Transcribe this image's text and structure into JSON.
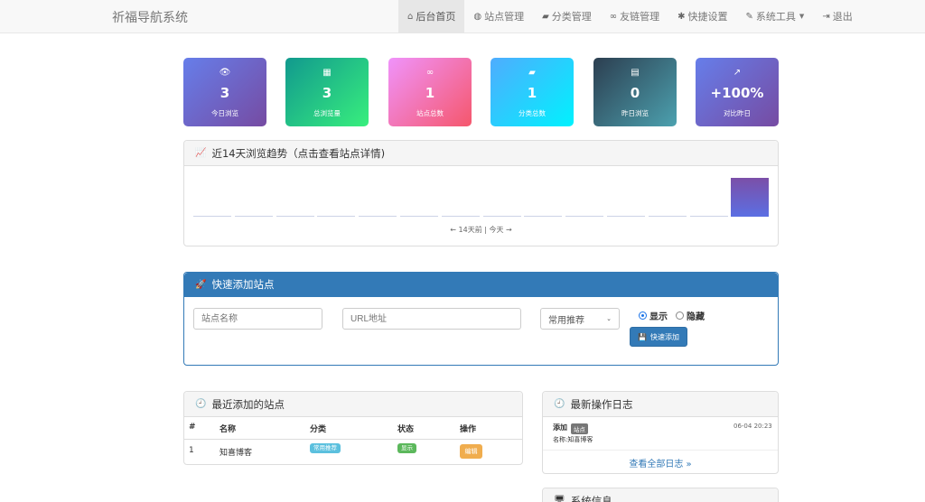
{
  "brand": "祈福导航系统",
  "nav": {
    "items": [
      {
        "label": "后台首页",
        "icon": "home-icon",
        "glyph": "⌂"
      },
      {
        "label": "站点管理",
        "icon": "globe-icon",
        "glyph": "◍"
      },
      {
        "label": "分类管理",
        "icon": "folder-open-icon",
        "glyph": "▰"
      },
      {
        "label": "友链管理",
        "icon": "link-icon",
        "glyph": "∞"
      },
      {
        "label": "快捷设置",
        "icon": "gear-icon",
        "glyph": "✱"
      },
      {
        "label": "系统工具",
        "icon": "wrench-icon",
        "glyph": "✎"
      },
      {
        "label": "退出",
        "icon": "logout-icon",
        "glyph": "⇥"
      }
    ]
  },
  "stats": [
    {
      "value": "3",
      "label": "今日浏览",
      "icon": "eye-icon",
      "glyph": "👁",
      "colors": [
        "#667eea",
        "#764ba2"
      ]
    },
    {
      "value": "3",
      "label": "总浏览量",
      "icon": "bar-chart-icon",
      "glyph": "▦",
      "colors": [
        "#11998e",
        "#38ef7d"
      ]
    },
    {
      "value": "1",
      "label": "站点总数",
      "icon": "link-icon",
      "glyph": "∞",
      "colors": [
        "#f093fb",
        "#f5576c"
      ]
    },
    {
      "value": "1",
      "label": "分类总数",
      "icon": "folder-icon",
      "glyph": "▰",
      "colors": [
        "#4facfe",
        "#00f2fe"
      ]
    },
    {
      "value": "0",
      "label": "昨日浏览",
      "icon": "calendar-icon",
      "glyph": "▤",
      "colors": [
        "#2c3e50",
        "#4ca1af"
      ]
    },
    {
      "value": "+100%",
      "label": "对比昨日",
      "icon": "trend-icon",
      "glyph": "↗",
      "colors": [
        "#667eea",
        "#764ba2"
      ]
    }
  ],
  "trend": {
    "title": "近14天浏览趋势（点击查看站点详情)",
    "icon": "trend-chart-icon",
    "footer": "← 14天前 | 今天 →"
  },
  "chart_data": {
    "type": "bar",
    "title": "近14天浏览趋势（点击查看站点详情)",
    "values": [
      0,
      0,
      0,
      0,
      0,
      0,
      0,
      0,
      0,
      0,
      0,
      0,
      0,
      3
    ],
    "xlabel": "← 14天前 | 今天 →",
    "ylabel": "",
    "grid": false
  },
  "quick_add": {
    "title": "快速添加站点",
    "name_placeholder": "站点名称",
    "url_placeholder": "URL地址",
    "category_selected": "常用推荐",
    "show_label": "显示",
    "hide_label": "隐藏",
    "visibility": "显示",
    "submit_label": "快速添加"
  },
  "recent_sites": {
    "title": "最近添加的站点",
    "columns": [
      "#",
      "名称",
      "分类",
      "状态",
      "操作"
    ],
    "rows": [
      {
        "index": "1",
        "name": "知喜博客",
        "category": "常用推荐",
        "status": "显示",
        "action": "编辑"
      }
    ]
  },
  "logs": {
    "title": "最新操作日志",
    "entries": [
      {
        "type": "添加",
        "tag": "站点",
        "time": "06-04 20:23",
        "detail": "名称:知喜博客"
      }
    ],
    "view_all": "查看全部日志 »"
  },
  "system_info": {
    "title": "系统信息"
  },
  "colors": {
    "primary": "#337ab7",
    "info_badge": "#5bc0de",
    "success_badge": "#5cb85c",
    "warning": "#f0ad4e"
  }
}
